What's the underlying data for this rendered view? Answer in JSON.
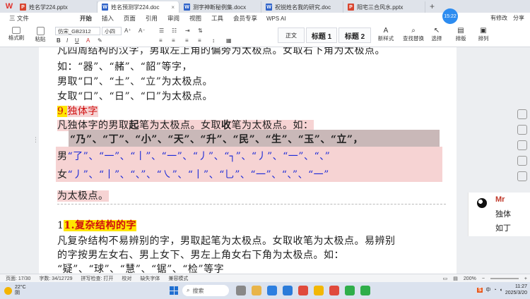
{
  "tabs": [
    {
      "label": "姓名学224.pptx",
      "type": "p"
    },
    {
      "label": "姓名预测学224.doc",
      "type": "w",
      "active": true
    },
    {
      "label": "测字神断秘例集.docx",
      "type": "w"
    },
    {
      "label": "祝锐姓名我的研究.doc",
      "type": "w"
    },
    {
      "label": "阳宅三合风水.pptx",
      "type": "p"
    }
  ],
  "tab_close": "×",
  "tab_plus": "+",
  "menu": {
    "file": "三 文件",
    "items": [
      "开始",
      "插入",
      "页面",
      "引用",
      "审阅",
      "视图",
      "工具",
      "会员专享"
    ],
    "active": "开始",
    "wps_ai": "WPS AI",
    "right": [
      "有修改",
      "分享"
    ]
  },
  "clock_badge": "15:22",
  "ribbon": {
    "format_painter": "格式刷",
    "paste": "粘贴",
    "font_name": "仿宋_GB2312",
    "font_size": "小四",
    "styles": [
      "正文",
      "标题 1",
      "标题 2"
    ],
    "new_style": "新样式",
    "find_replace": "查找替换",
    "select": "选择",
    "layout": "排版",
    "arrange": "排列"
  },
  "document": {
    "line1": "凡四周结构的汉字，男取左上角的偏旁为太极点。女取右下角为太极点。",
    "line2": "如：“器”、“赭”、“韶”等字，",
    "line3": "男取“口”、“土”、“立”为太极点。",
    "line4": "女取“口”、“日”、“口”为太极点。",
    "heading9_num": "9.",
    "heading9_text": "独体字",
    "line6_a": "凡独体字的男取",
    "line6_b": "起",
    "line6_c": "笔为太极点。女取",
    "line6_d": "收",
    "line6_e": "笔为太极点。如：",
    "line7": "“乃”、“丁”、“小”、“天”、“升”、“民”、“生”、“玉”、“立”，",
    "line8_label": "男",
    "line8_strokes": "“了”、“一”、“丨”、“一”、“丿”、“┐”、“丿”、“一”、“、”",
    "line9_label": "女",
    "line9_strokes": "“丿”、“丨”、“、”、“㇏”、“丨”、“乚”、“一”、“、”、“一”",
    "line10": "为太极点。",
    "heading10_prefix": "1",
    "heading10_text": "1.复杂结构的字",
    "line12": "凡复杂结构不易辨别的字，男取起笔为太极点。女取收笔为太极点。易辨别",
    "line13": "的字按男左女右、男上女下、男左上角女右下角为太极点。如：",
    "line14": "“疑”、“球”、“慧”、“锯”、“检”等字"
  },
  "side_panel": {
    "title": "Mr",
    "line1": "独体",
    "line2": "如丁"
  },
  "status": {
    "page": "页面: 17/30",
    "words": "字数: 34/12729",
    "spell": "拼写检查: 打开",
    "proof": "校对",
    "missing_font": "缺失字体",
    "compat": "兼容模式",
    "zoom": "200%"
  },
  "taskbar": {
    "temp": "22°C",
    "weather": "阴",
    "search": "搜索",
    "time": "11:27",
    "date": "2025/3/20",
    "lang": "中"
  },
  "colors": {
    "accent": "#2f63c9",
    "highlight_pink": "#f6d3d3",
    "highlight_yellow": "#ffe600",
    "heading_red": "#d01010",
    "stroke_blue": "#1d2bd8"
  }
}
